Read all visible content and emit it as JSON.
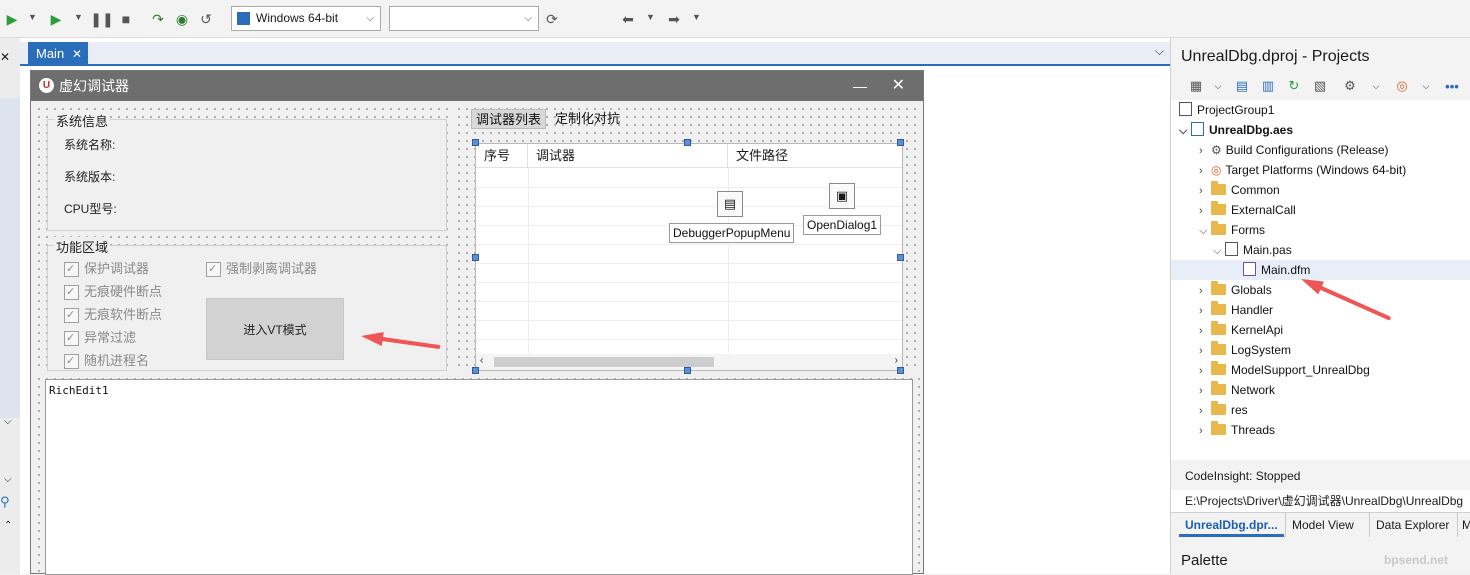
{
  "toolbar": {
    "platform": "Windows 64-bit",
    "config": ""
  },
  "editor": {
    "tab": "Main"
  },
  "form": {
    "title": "虚幻调试器",
    "sysinfo": {
      "title": "系统信息",
      "name": "系统名称:",
      "version": "系统版本:",
      "cpu": "CPU型号:"
    },
    "func": {
      "title": "功能区域",
      "checks": [
        "保护调试器",
        "无痕硬件断点",
        "无痕软件断点",
        "异常过滤",
        "随机进程名"
      ],
      "check_force": "强制剥离调试器",
      "vt_button": "进入VT模式"
    },
    "tabs": [
      "调试器列表",
      "定制化对抗"
    ],
    "grid_headers": [
      "序号",
      "调试器",
      "文件路径"
    ],
    "popup_menu": "DebuggerPopupMenu",
    "open_dialog": "OpenDialog1",
    "richedit": "RichEdit1"
  },
  "projects": {
    "title": "UnrealDbg.dproj - Projects",
    "group": "ProjectGroup1",
    "project": "UnrealDbg.aes",
    "nodes": {
      "build": "Build Configurations (Release)",
      "target": "Target Platforms (Windows 64-bit)",
      "common": "Common",
      "external": "ExternalCall",
      "forms": "Forms",
      "mainpas": "Main.pas",
      "maindfm": "Main.dfm",
      "globals": "Globals",
      "handler": "Handler",
      "kernelapi": "KernelApi",
      "logsystem": "LogSystem",
      "modelsupport": "ModelSupport_UnrealDbg",
      "network": "Network",
      "res": "res",
      "threads": "Threads"
    },
    "status": "CodeInsight: Stopped",
    "path": "E:\\Projects\\Driver\\虚幻调试器\\UnrealDbg\\UnrealDbg",
    "bottom_tabs": [
      "UnrealDbg.dpr...",
      "Model View",
      "Data Explorer",
      "M"
    ],
    "palette": "Palette"
  },
  "watermark": "bpsend.net"
}
